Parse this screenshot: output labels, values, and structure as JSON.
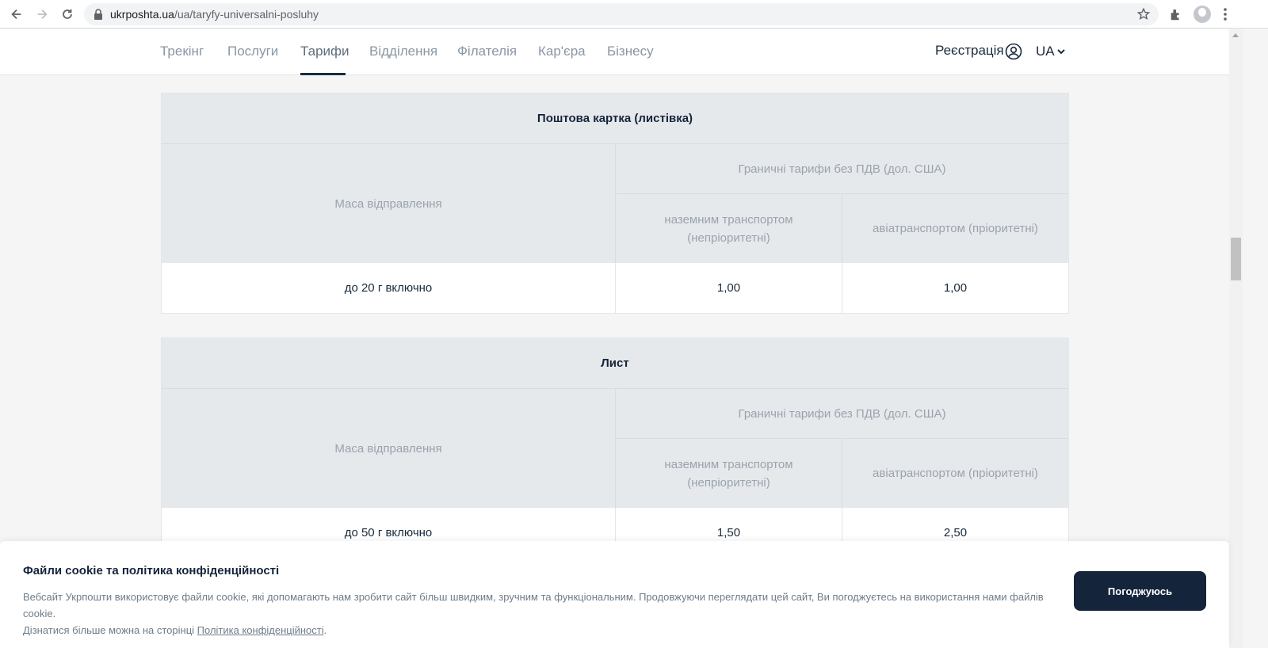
{
  "browser": {
    "url_host": "ukrposhta.ua",
    "url_path": "/ua/taryfy-universalni-posluhy"
  },
  "header": {
    "nav": [
      "Трекінг",
      "Послуги",
      "Тарифи",
      "Відділення",
      "Філателія",
      "Кар'єра",
      "Бізнесу"
    ],
    "active_tab": "Тарифи",
    "register_label": "Реєстрація",
    "lang_label": "UA"
  },
  "tables": [
    {
      "title": "Поштова картка (листівка)",
      "mass_header": "Маса відправлення",
      "limit_header": "Граничні тарифи без ПДВ (дол. США)",
      "ground_header_line1": "наземним транспортом",
      "ground_header_line2": "(непріоритетні)",
      "air_header": "авіатранспортом (пріоритетні)",
      "rows": [
        {
          "mass": "до 20 г включно",
          "ground": "1,00",
          "air": "1,00"
        }
      ]
    },
    {
      "title": "Лист",
      "mass_header": "Маса відправлення",
      "limit_header": "Граничні тарифи без ПДВ (дол. США)",
      "ground_header_line1": "наземним транспортом",
      "ground_header_line2": "(непріоритетні)",
      "air_header": "авіатранспортом (пріоритетні)",
      "rows": [
        {
          "mass": "до 50 г включно",
          "ground": "1,50",
          "air": "2,50"
        }
      ]
    }
  ],
  "cookie": {
    "title": "Файли cookie та політика конфіденційності",
    "text": "Вебсайт Укрпошти використовує файли cookie, які допомагають нам зробити сайт більш швидким, зручним та функціональним. Продовжуючи переглядати цей сайт, Ви погоджуєтесь на використання нами файлів cookie.",
    "text2": "Дізнатися більше можна на сторінці",
    "link": "Політика конфіденційності",
    "text_end": ".",
    "button": "Погоджуюсь"
  },
  "colors": {
    "accent": "#14243a",
    "header_bg": "#e6e9ec"
  }
}
